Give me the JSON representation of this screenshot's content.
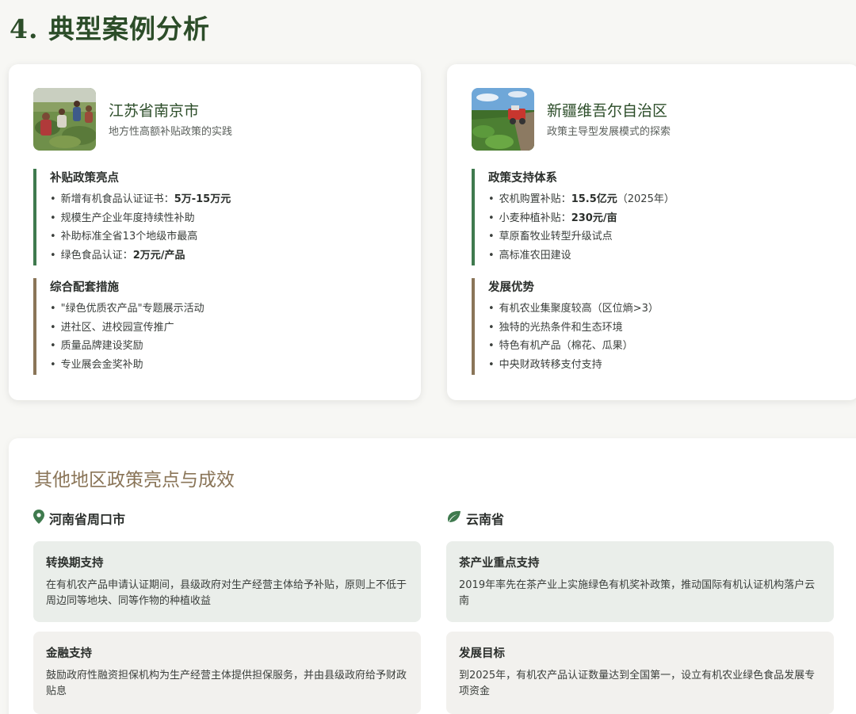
{
  "page": {
    "title": "4. 典型案例分析"
  },
  "cases": [
    {
      "name": "江苏省南京市",
      "subtitle": "地方性高额补贴政策的实践",
      "blocks": [
        {
          "title": "补贴政策亮点",
          "items": [
            {
              "text": "新增有机食品认证证书：",
              "bold": "5万-15万元"
            },
            {
              "text": "规模生产企业年度持续性补助",
              "bold": ""
            },
            {
              "text": "补助标准全省13个地级市最高",
              "bold": ""
            },
            {
              "text": "绿色食品认证：",
              "bold": "2万元/产品"
            }
          ]
        },
        {
          "title": "综合配套措施",
          "items": [
            {
              "text": "\"绿色优质农产品\"专题展示活动"
            },
            {
              "text": "进社区、进校园宣传推广"
            },
            {
              "text": "质量品牌建设奖励"
            },
            {
              "text": "专业展会金奖补助"
            }
          ]
        }
      ]
    },
    {
      "name": "新疆维吾尔自治区",
      "subtitle": "政策主导型发展模式的探索",
      "blocks": [
        {
          "title": "政策支持体系",
          "items": [
            {
              "text": "农机购置补贴：",
              "bold": "15.5亿元",
              "tail": "（2025年）"
            },
            {
              "text": "小麦种植补贴：",
              "bold": "230元/亩",
              "tail": ""
            },
            {
              "text": "草原畜牧业转型升级试点",
              "bold": "",
              "tail": ""
            },
            {
              "text": "高标准农田建设",
              "bold": "",
              "tail": ""
            }
          ]
        },
        {
          "title": "发展优势",
          "items": [
            {
              "text": "有机农业集聚度较高（区位熵>3）"
            },
            {
              "text": "独特的光热条件和生态环境"
            },
            {
              "text": "特色有机产品（棉花、瓜果）"
            },
            {
              "text": "中央财政转移支付支持"
            }
          ]
        }
      ]
    }
  ],
  "others": {
    "title": "其他地区政策亮点与成效",
    "regions": [
      {
        "name": "河南省周口市",
        "icon": "map-pin-icon",
        "panels": [
          {
            "title": "转换期支持",
            "text": "在有机农产品申请认证期间，县级政府对生产经营主体给予补贴，原则上不低于周边同等地块、同等作物的种植收益"
          },
          {
            "title": "金融支持",
            "text": "鼓励政府性融资担保机构为生产经营主体提供担保服务，并由县级政府给予财政贴息"
          }
        ]
      },
      {
        "name": "云南省",
        "icon": "leaf-icon",
        "panels": [
          {
            "title": "茶产业重点支持",
            "text": "2019年率先在茶产业上实施绿色有机奖补政策，推动国际有机认证机构落户云南"
          },
          {
            "title": "发展目标",
            "text": "到2025年，有机农产品认证数量达到全国第一，设立有机农业绿色食品发展专项资金"
          }
        ]
      }
    ]
  },
  "colors": {
    "primary_green": "#2c4d29",
    "accent_green": "#3f7a4e",
    "accent_brown": "#8a7558"
  }
}
